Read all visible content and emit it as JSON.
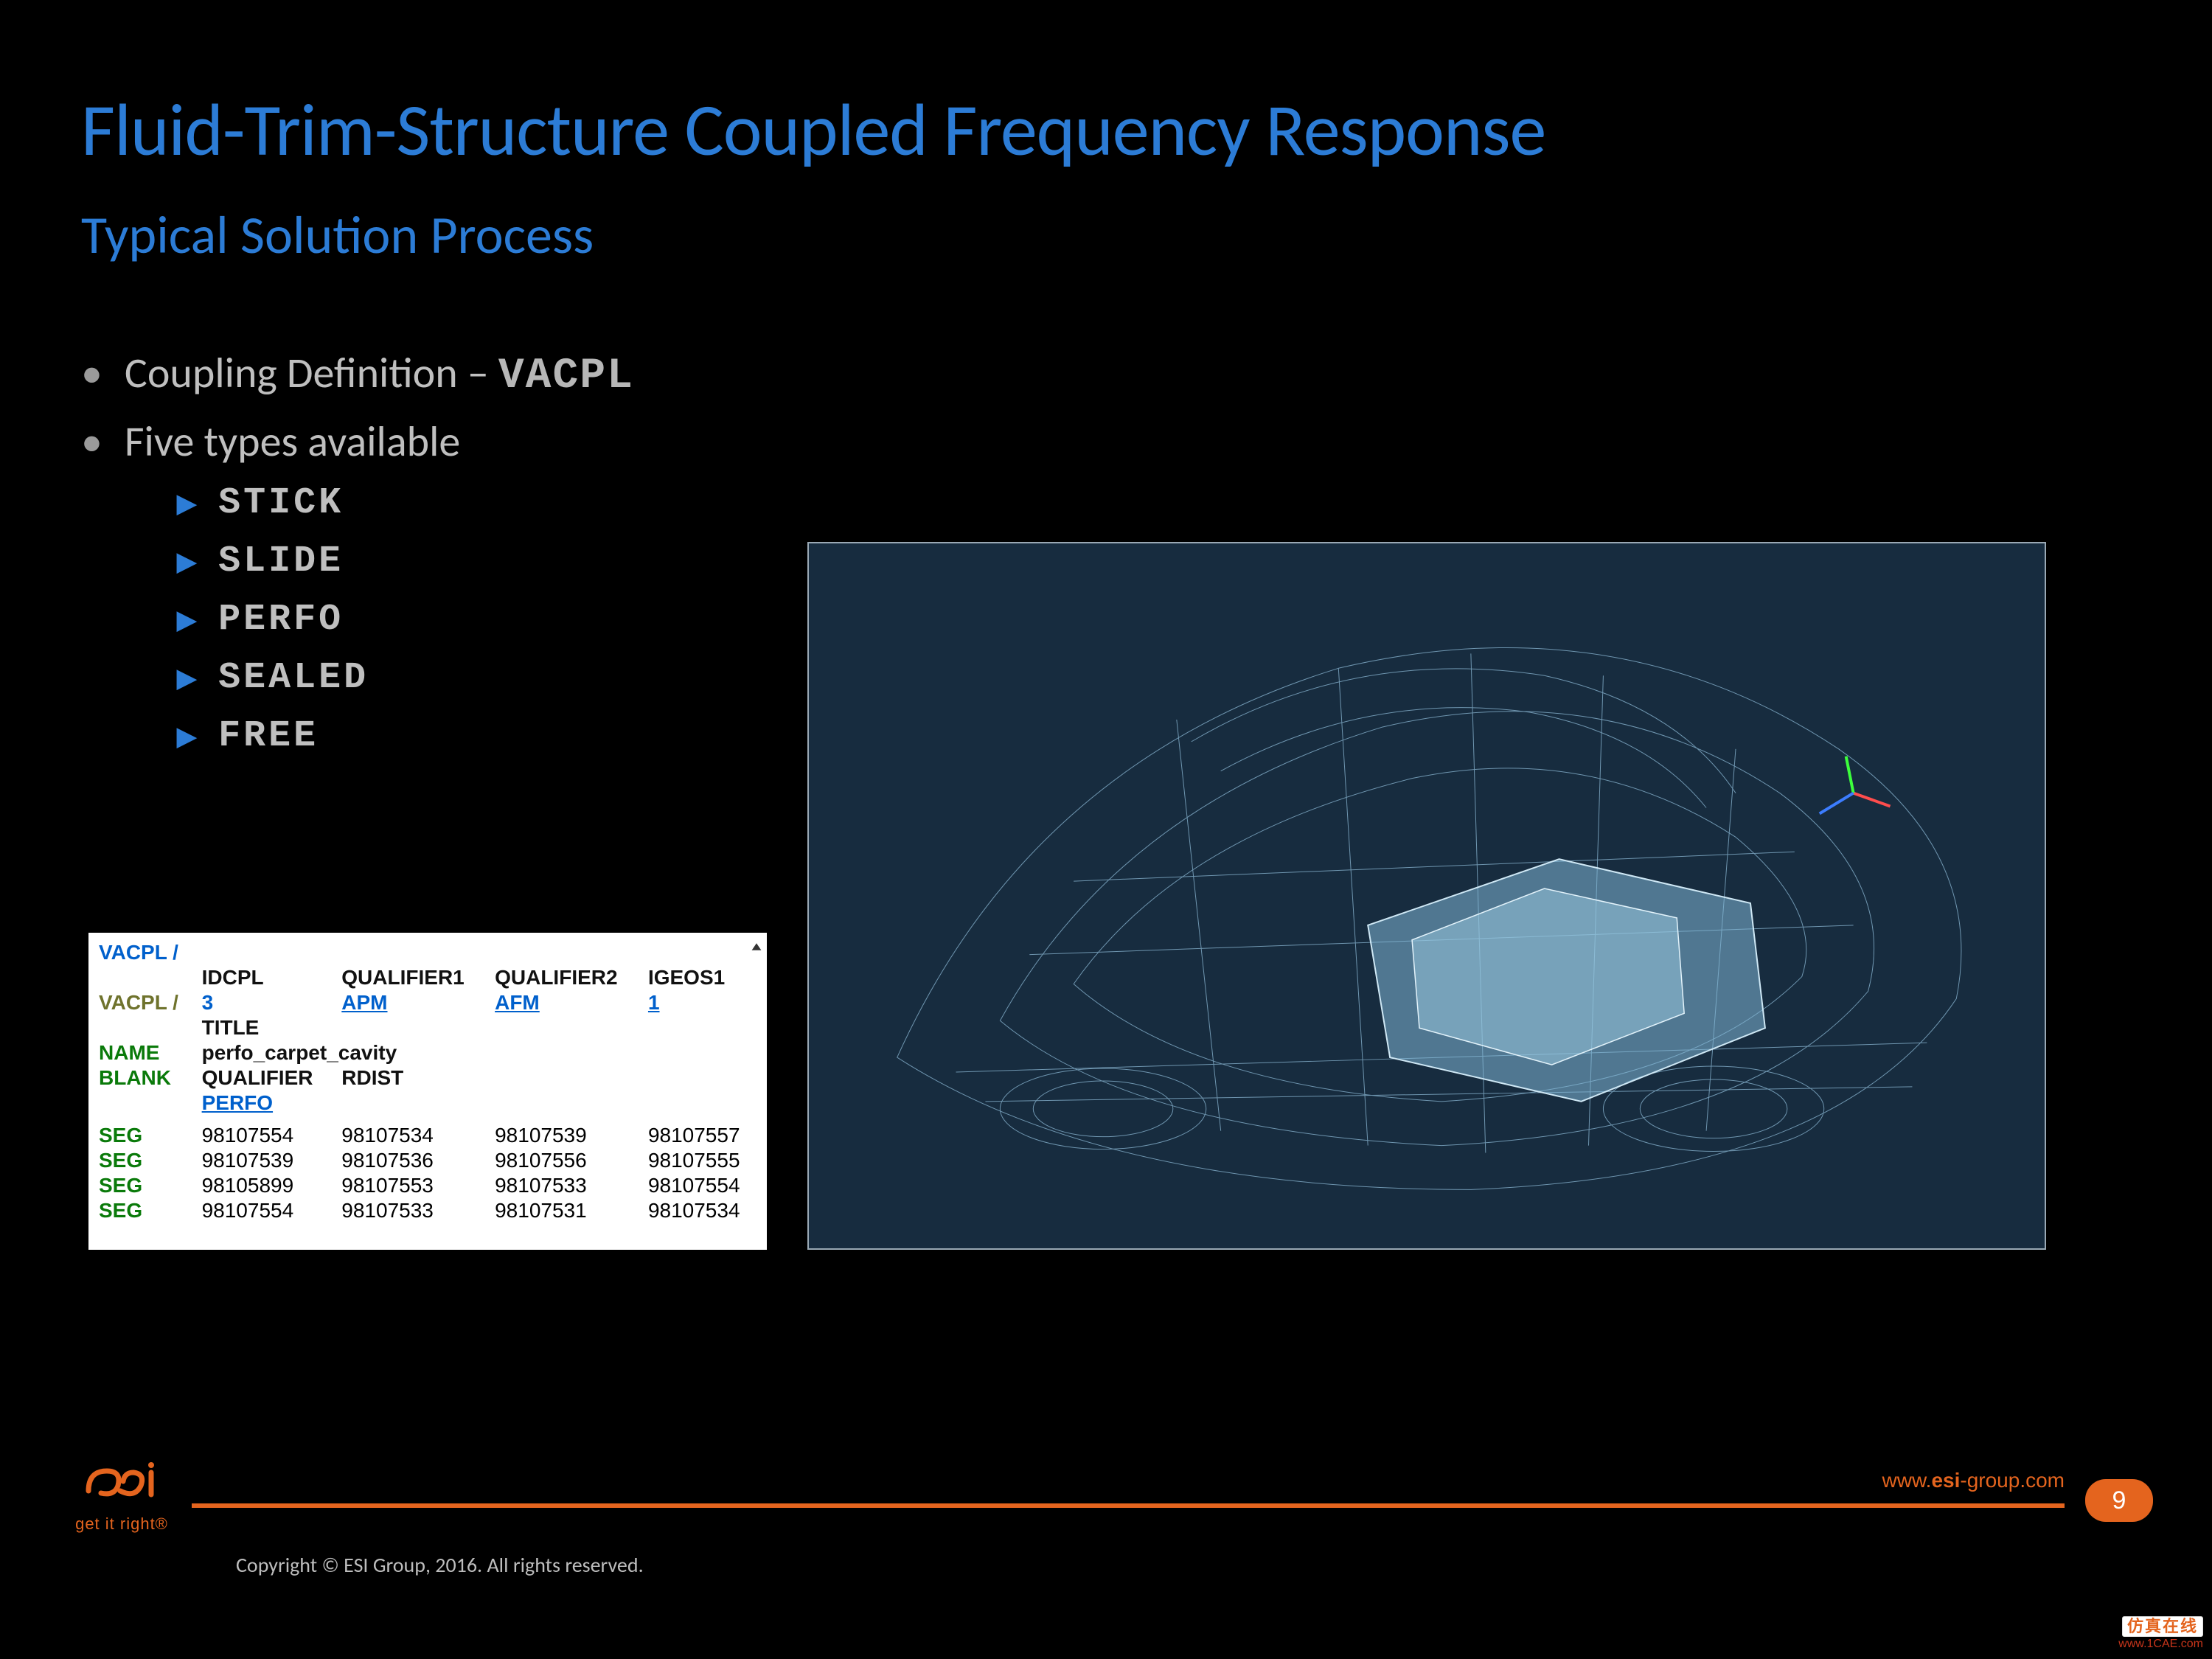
{
  "title": "Fluid-Trim-Structure Coupled Frequency Response",
  "subtitle": "Typical Solution Process",
  "bullets": {
    "l1": [
      {
        "prefix": "Coupling Definition – ",
        "strong": "VACPL"
      },
      {
        "prefix": "Five types available",
        "strong": ""
      }
    ],
    "l2": [
      "STICK",
      "SLIDE",
      "PERFO",
      "SEALED",
      "FREE"
    ]
  },
  "card": {
    "header_row_label": "VACPL /",
    "columns": [
      "IDCPL",
      "QUALIFIER1",
      "QUALIFIER2",
      "IGEOS1"
    ],
    "row_vacpl": {
      "label": "VACPL /",
      "idcpl": "3",
      "q1": "APM",
      "q2": "AFM",
      "igeos1": "1"
    },
    "row_title_label": "TITLE",
    "row_name": {
      "label": "NAME",
      "value": "perfo_carpet_cavity"
    },
    "row_blank": {
      "label": "BLANK",
      "q_label": "QUALIFIER",
      "r_label": "RDIST",
      "q_value": "PERFO"
    },
    "seg": [
      [
        "SEG",
        "98107554",
        "98107534",
        "98107539",
        "98107557"
      ],
      [
        "SEG",
        "98107539",
        "98107536",
        "98107556",
        "98107555"
      ],
      [
        "SEG",
        "98105899",
        "98107553",
        "98107533",
        "98107554"
      ],
      [
        "SEG",
        "98107554",
        "98107533",
        "98107531",
        "98107534"
      ]
    ]
  },
  "viewport": {
    "label": "car-wireframe-view"
  },
  "footer": {
    "tagline": "get it right®",
    "site_prefix": "www.",
    "site_bold": "esi",
    "site_suffix": "-group.com",
    "page": "9",
    "copyright": "Copyright © ESI Group, 2016. All rights reserved."
  },
  "watermark": {
    "line1": "仿真在线",
    "line2": "www.1CAE.com"
  }
}
